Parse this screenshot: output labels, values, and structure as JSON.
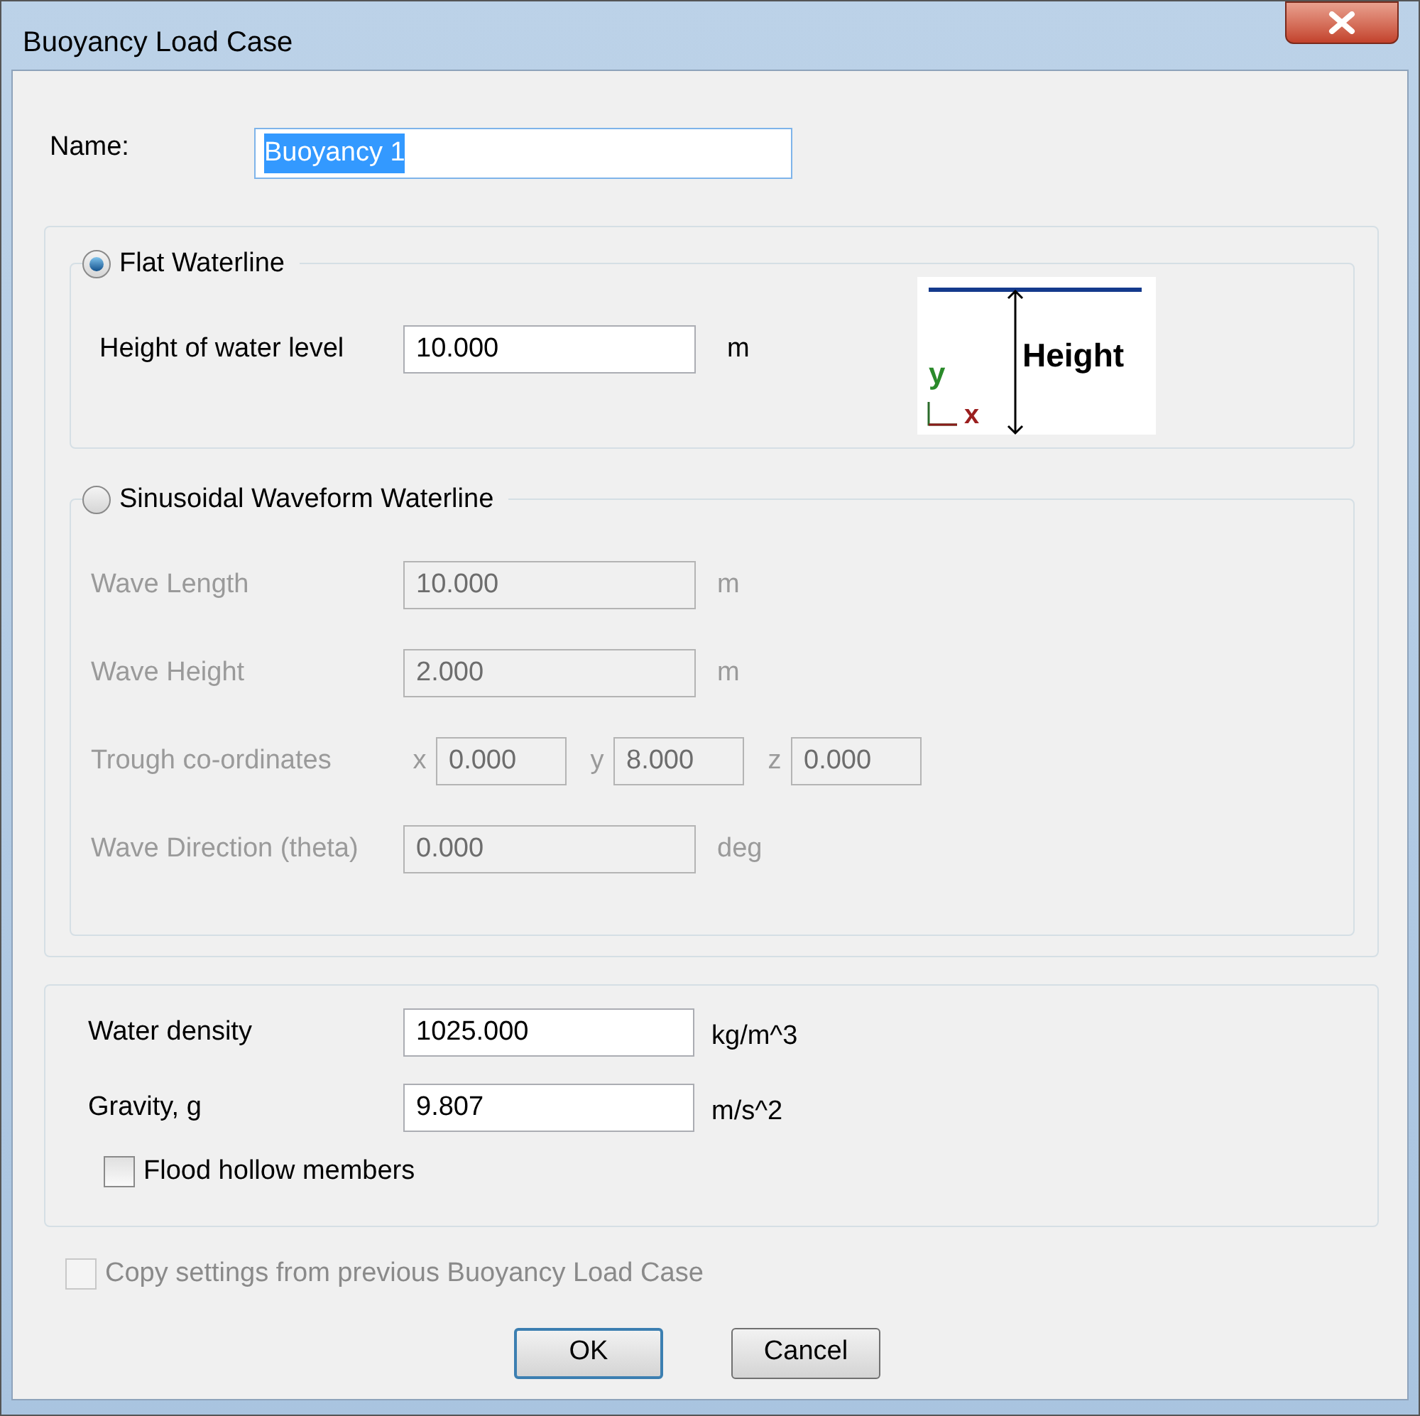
{
  "window": {
    "title": "Buoyancy Load Case"
  },
  "name_field": {
    "label": "Name:",
    "value": "Buoyancy 1",
    "text_selected": true
  },
  "flat_waterline": {
    "label": "Flat Waterline",
    "selected": true,
    "field": {
      "label": "Height of water level",
      "value": "10.000",
      "unit": "m"
    },
    "diagram": {
      "label": "Height",
      "y_axis": "y",
      "x_axis": "x"
    }
  },
  "sinusoidal_waterline": {
    "label": "Sinusoidal Waveform Waterline",
    "selected": false,
    "disabled": true,
    "fields": [
      {
        "kind": "single",
        "label": "Wave Length",
        "value": "10.000",
        "unit": "m"
      },
      {
        "kind": "single",
        "label": "Wave Height",
        "value": "2.000",
        "unit": "m"
      },
      {
        "kind": "coords",
        "label": "Trough co-ordinates",
        "coords": [
          {
            "axis": "x",
            "value": "0.000"
          },
          {
            "axis": "y",
            "value": "8.000"
          },
          {
            "axis": "z",
            "value": "0.000"
          }
        ]
      },
      {
        "kind": "single",
        "label": "Wave Direction (theta)",
        "value": "0.000",
        "unit": "deg"
      }
    ]
  },
  "physical": {
    "fields": [
      {
        "label": "Water density",
        "value": "1025.000",
        "unit": "kg/m^3"
      },
      {
        "label": "Gravity, g",
        "value": "9.807",
        "unit": "m/s^2"
      }
    ],
    "flood_hollow_members": {
      "label": "Flood hollow members",
      "checked": false
    }
  },
  "copy_settings": {
    "label": "Copy settings from previous Buoyancy Load Case",
    "checked": false,
    "disabled": true
  },
  "buttons": [
    {
      "label": "OK",
      "default": true
    },
    {
      "label": "Cancel",
      "default": false
    }
  ]
}
